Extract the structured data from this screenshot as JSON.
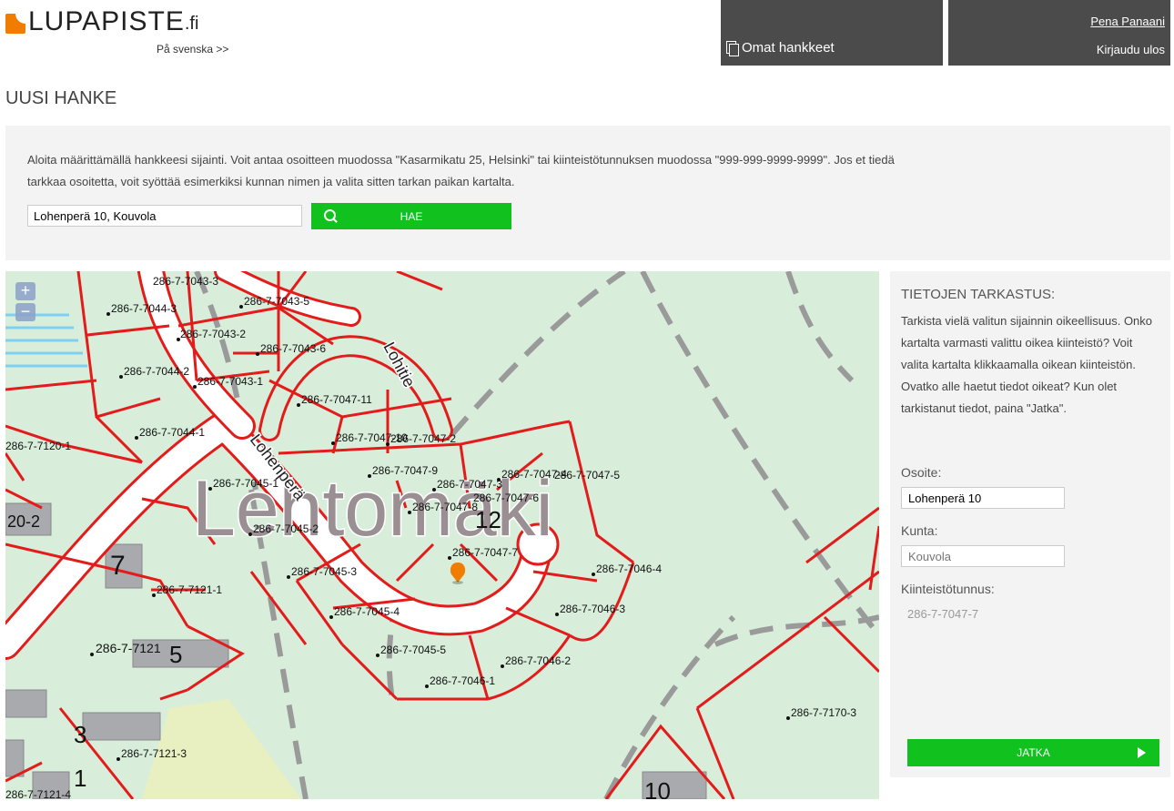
{
  "header": {
    "logo_main": "LUPAPISTE",
    "logo_tld": ".fi",
    "language_link": "På svenska >>",
    "projects_link": "Omat hankkeet",
    "user_name": "Pena Panaani",
    "logout": "Kirjaudu ulos"
  },
  "page_title": "UUSI HANKE",
  "search": {
    "intro": "Aloita määrittämällä hankkeesi sijainti. Voit antaa osoitteen muodossa \"Kasarmikatu 25, Helsinki\" tai kiinteistötunnuksen muodossa \"999-999-9999-9999\". Jos et tiedä tarkkaa osoitetta, voit syöttää esimerkiksi kunnan nimen ja valita sitten tarkan paikan kartalta.",
    "input_value": "Lohenperä 10, Kouvola",
    "button_label": "HAE"
  },
  "map": {
    "zoom_in": "+",
    "zoom_out": "−",
    "area_name": "Lehtomäki",
    "streets": [
      "Lohenperä",
      "Lohitie"
    ],
    "parcel_labels": [
      "286-7-7043-3",
      "286-7-7044-3",
      "286-7-7043-2",
      "286-7-7043-5",
      "286-7-7043-6",
      "286-7-7044-2",
      "286-7-7043-1",
      "286-7-7047-11",
      "286-7-7044-1",
      "286-7-7047-10",
      "286-7-7047-2",
      "286-7-7045-1",
      "286-7-7047-9",
      "286-7-7047-3",
      "286-7-7047-4",
      "286-7-7047-5",
      "286-7-7047-8",
      "286-7-7047-6",
      "286-7-7045-2",
      "286-7-7047-7",
      "286-7-7046-4",
      "286-7-7045-3",
      "286-7-7121-1",
      "286-7-7046-3",
      "286-7-7045-4",
      "286-7-7121",
      "286-7-7045-5",
      "286-7-7046-2",
      "286-7-7046-1",
      "286-7-7170-3",
      "286-7-7121-3",
      "286-7-7121-4",
      "286-7-7120-1"
    ],
    "block_numbers": [
      "12",
      "7",
      "5",
      "3",
      "1",
      "10",
      "20-2"
    ]
  },
  "info": {
    "title": "TIETOJEN TARKASTUS:",
    "text": "Tarkista vielä valitun sijainnin oikeellisuus. Onko kartalta varmasti valittu oikea kiinteistö? Voit valita kartalta klikkaamalla oikean kiinteistön. Ovatko alle haetut tiedot oikeat? Kun olet tarkistanut tiedot, paina \"Jatka\".",
    "address_label": "Osoite:",
    "address_value": "Lohenperä 10",
    "municipality_label": "Kunta:",
    "municipality_placeholder": "Kouvola",
    "parcel_label": "Kiinteistötunnus:",
    "parcel_value": "286-7-7047-7",
    "continue_label": "JATKA"
  },
  "colors": {
    "accent": "#11c11d",
    "header_bg": "#4b4b4b",
    "logo": "#f07d00",
    "parcel_border": "#e31b1b",
    "map_bg": "#d8eedb"
  }
}
